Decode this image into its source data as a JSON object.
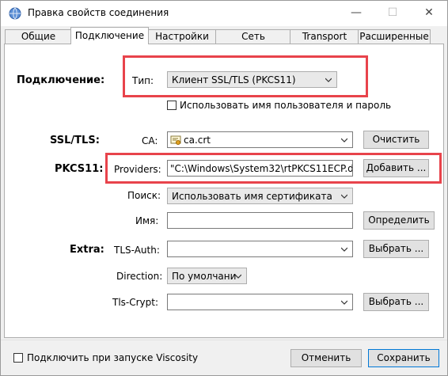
{
  "window": {
    "title": "Правка свойств соединения",
    "min_glyph": "—",
    "max_glyph": "☐",
    "close_glyph": "✕"
  },
  "tabs": [
    {
      "label": "Общие"
    },
    {
      "label": "Подключение"
    },
    {
      "label": "Настройки"
    },
    {
      "label": "Сеть"
    },
    {
      "label": "Transport"
    },
    {
      "label": "Расширенные"
    }
  ],
  "active_tab": "Подключение",
  "connection": {
    "section_label": "Подключение:",
    "type_label": "Тип:",
    "type_value": "Клиент SSL/TLS (PKCS11)",
    "use_credentials_label": "Использовать имя пользователя и пароль",
    "use_credentials_checked": false
  },
  "ssl": {
    "section_label": "SSL/TLS:",
    "ca_label": "CA:",
    "ca_value": "ca.crt",
    "clear_button": "Очистить"
  },
  "pkcs11": {
    "section_label": "PKCS11:",
    "providers_label": "Providers:",
    "providers_value": "\"C:\\Windows\\System32\\rtPKCS11ECP.d",
    "add_button": "Добавить ...",
    "search_label": "Поиск:",
    "search_value": "Использовать имя сертификата",
    "name_label": "Имя:",
    "name_value": "",
    "detect_button": "Определить"
  },
  "extra": {
    "section_label": "Extra:",
    "tls_auth_label": "TLS-Auth:",
    "tls_auth_value": "",
    "tls_auth_button": "Выбрать ...",
    "direction_label": "Direction:",
    "direction_value": "По умолчани",
    "tls_crypt_label": "Tls-Crypt:",
    "tls_crypt_value": "",
    "tls_crypt_button": "Выбрать ..."
  },
  "footer": {
    "autostart_label": "Подключить при запуске Viscosity",
    "autostart_checked": false,
    "cancel_button": "Отменить",
    "save_button": "Сохранить"
  },
  "colors": {
    "highlight": "#e8434b",
    "accent": "#0078d7"
  },
  "icons": [
    "app-globe-icon",
    "chevron-down-icon",
    "certificate-icon"
  ]
}
